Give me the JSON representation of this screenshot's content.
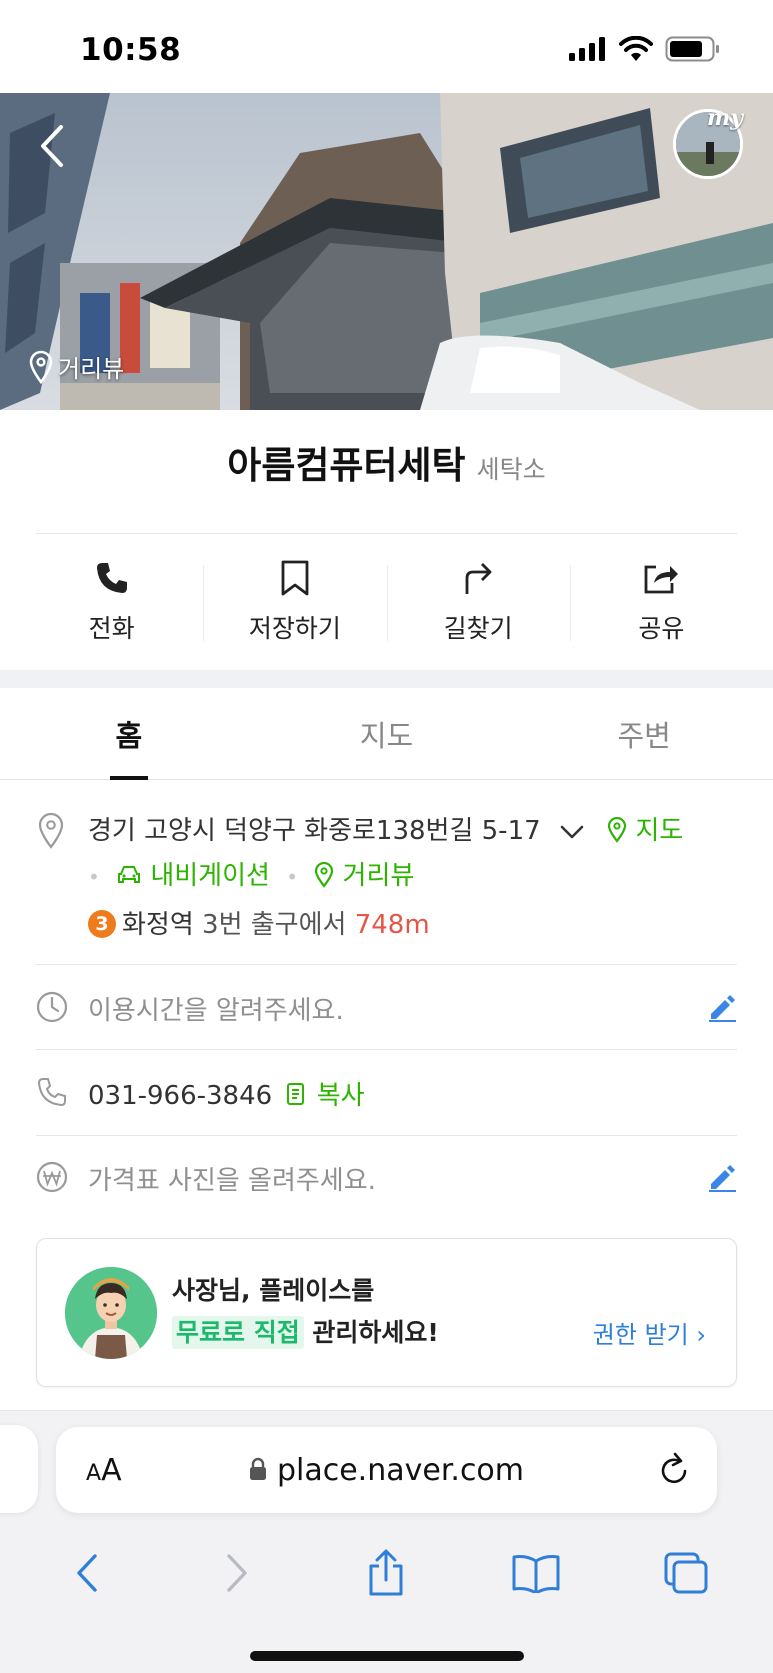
{
  "status_bar": {
    "time": "10:58"
  },
  "hero": {
    "my_label": "my",
    "streetview_label": "거리뷰"
  },
  "place": {
    "name": "아름컴퓨터세탁",
    "category": "세탁소"
  },
  "actions": [
    {
      "label": "전화",
      "icon": "phone-icon"
    },
    {
      "label": "저장하기",
      "icon": "bookmark-icon"
    },
    {
      "label": "길찾기",
      "icon": "directions-icon"
    },
    {
      "label": "공유",
      "icon": "share-icon"
    }
  ],
  "tabs": [
    {
      "label": "홈",
      "active": true
    },
    {
      "label": "지도",
      "active": false
    },
    {
      "label": "주변",
      "active": false
    }
  ],
  "address": {
    "text": "경기 고양시 덕양구 화중로138번길 5-17",
    "map_link": "지도",
    "navigation_link": "내비게이션",
    "streetview_link": "거리뷰"
  },
  "transit": {
    "line_number": "3",
    "station": "화정역",
    "exit_text": "3번 출구에서",
    "distance": "748m"
  },
  "hours": {
    "placeholder": "이용시간을 알려주세요."
  },
  "phone": {
    "number": "031-966-3846",
    "copy_label": "복사"
  },
  "price": {
    "placeholder": "가격표 사진을 올려주세요."
  },
  "owner_card": {
    "line1": "사장님, 플레이스를",
    "highlight": "무료로 직접",
    "line2_rest": " 관리하세요!",
    "link": "권한 받기",
    "link_chevron": "›"
  },
  "browser": {
    "aa_small": "A",
    "aa_large": "A",
    "url": "place.naver.com"
  },
  "colors": {
    "green": "#2db400",
    "distance_red": "#e45748",
    "link_blue": "#2f7fd9",
    "safari_blue": "#2f7fd9",
    "metro_line3": "#ef7c1c"
  }
}
